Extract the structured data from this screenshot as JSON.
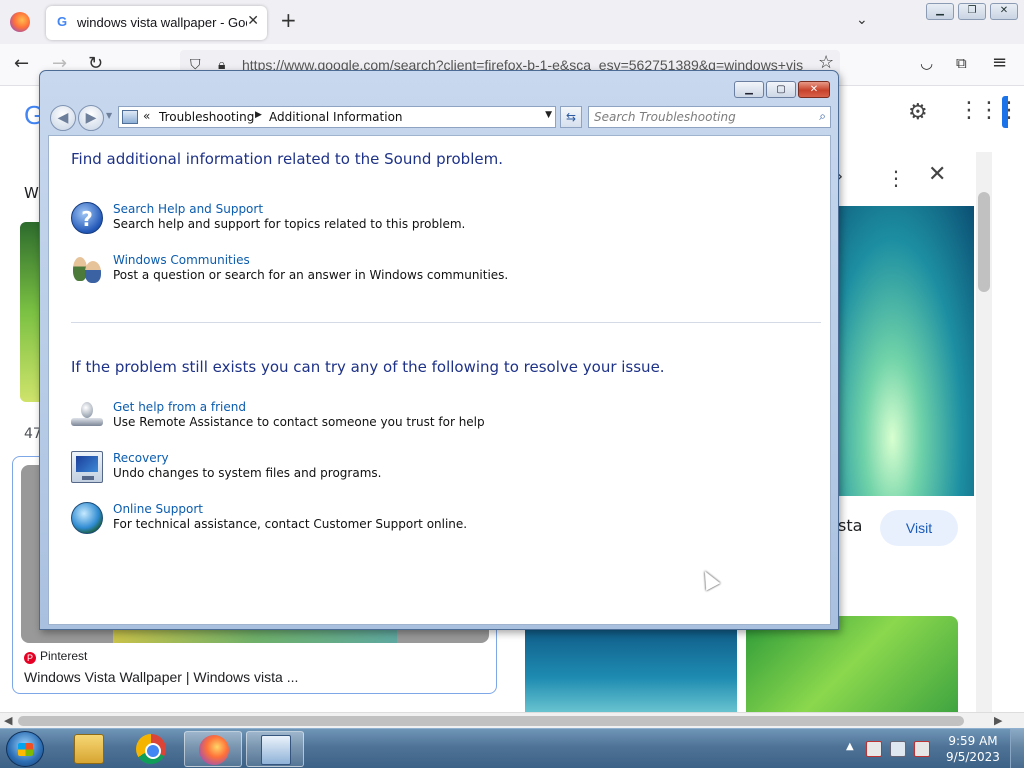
{
  "browser": {
    "tab_title": "windows vista wallpaper - Goo",
    "tab_close": "✕",
    "new_tab": "+",
    "list_tabs": "⌄",
    "url": "https://www.google.com/search?client=firefox-b-1-e&sca_esv=562751389&q=windows+vis"
  },
  "google": {
    "left_title_fragment": "Wi",
    "left_count_fragment": "47",
    "card_source": "Pinterest",
    "card_title": "Windows Vista Wallpaper | Windows vista ...",
    "right_title_fragment": "sta",
    "visit_label": "Visit"
  },
  "troubleshoot": {
    "breadcrumb": [
      "Troubleshooting",
      "Additional Information"
    ],
    "search_placeholder": "Search Troubleshooting",
    "heading1": "Find additional information related to the Sound problem.",
    "group1": [
      {
        "title": "Search Help and Support",
        "desc": "Search help and support for topics related to this problem.",
        "icon": "help-icon"
      },
      {
        "title": "Windows Communities",
        "desc": "Post a question or search for an answer in Windows communities.",
        "icon": "communities-icon"
      }
    ],
    "heading2": "If the problem still exists you can try any of the following to resolve your issue.",
    "group2": [
      {
        "title": "Get help from a friend",
        "desc": "Use Remote Assistance to contact someone you trust for help",
        "icon": "remote-assistance-icon"
      },
      {
        "title": "Recovery",
        "desc": "Undo changes to system files and programs.",
        "icon": "recovery-icon"
      },
      {
        "title": "Online Support",
        "desc": "For technical assistance, contact Customer Support online.",
        "icon": "globe-icon"
      }
    ]
  },
  "taskbar": {
    "time": "9:59 AM",
    "date": "9/5/2023"
  },
  "colors": {
    "heading": "#1e3287",
    "link": "#0b5cad",
    "taskbar": "#4e7396"
  }
}
